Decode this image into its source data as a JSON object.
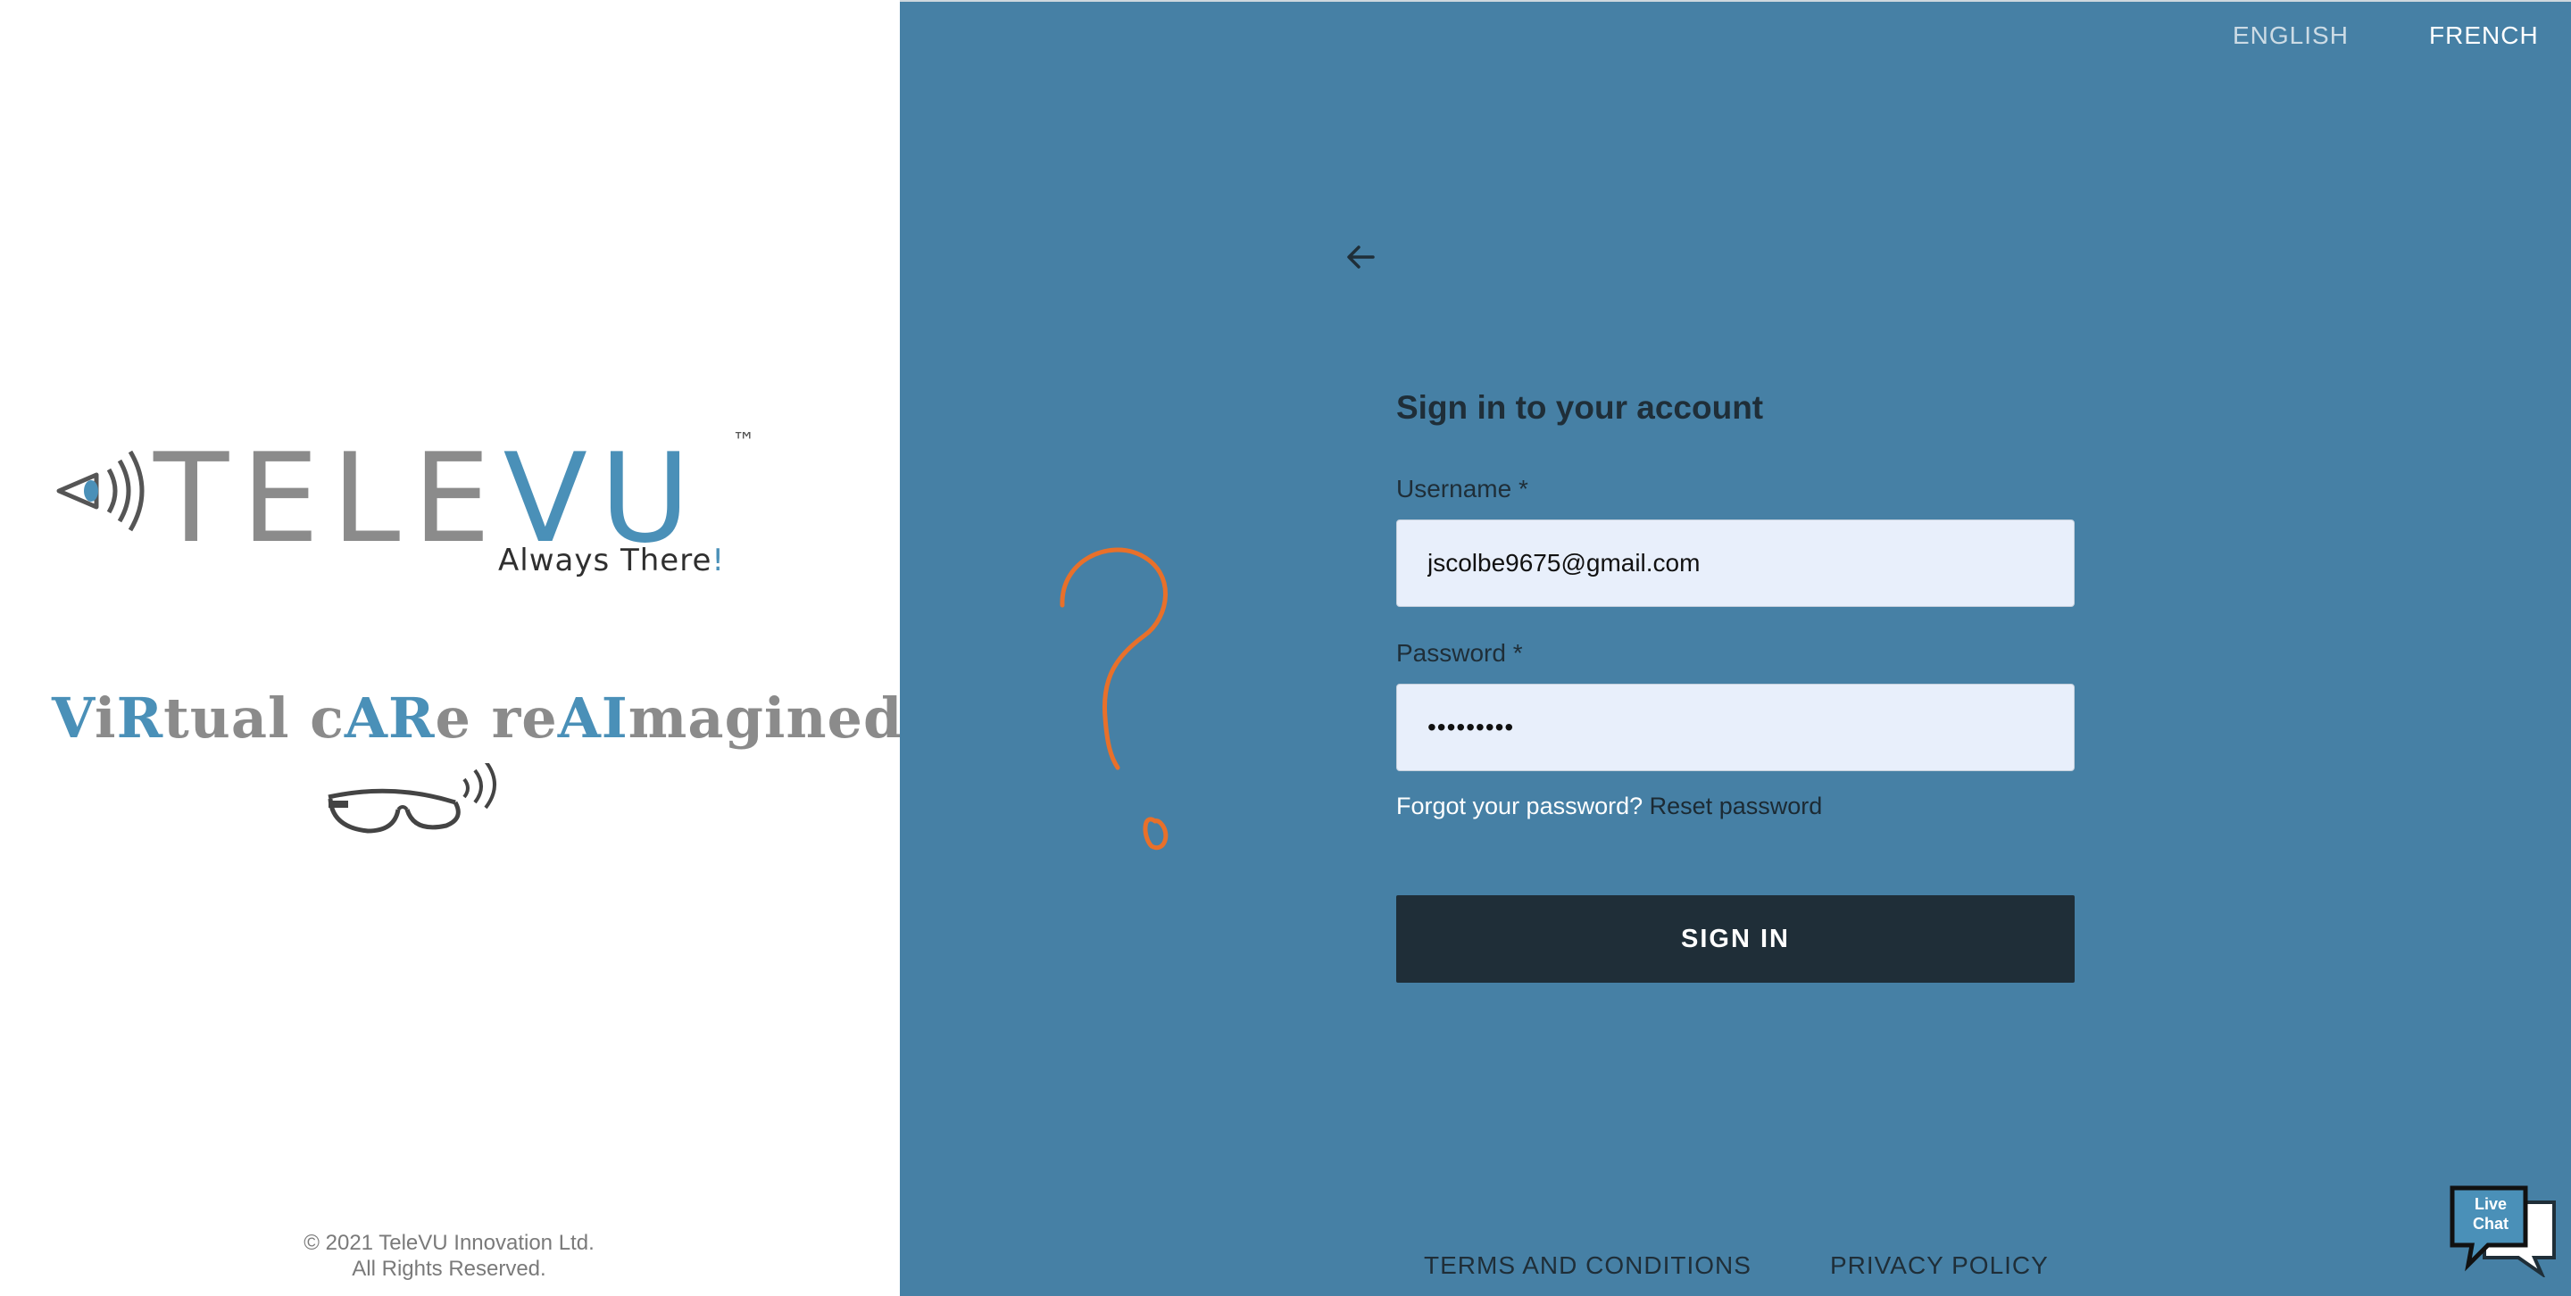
{
  "brand": {
    "logo_word_part1": "TELE",
    "logo_word_part2": "VU",
    "logo_tm": "™",
    "tagline_main": "Always There",
    "tagline_bang": "!",
    "slogan": [
      {
        "t": "V",
        "hi": true
      },
      {
        "t": "i",
        "hi": false
      },
      {
        "t": "R",
        "hi": true
      },
      {
        "t": "tual c",
        "hi": false
      },
      {
        "t": "AR",
        "hi": true
      },
      {
        "t": "e re",
        "hi": false
      },
      {
        "t": "AI",
        "hi": true
      },
      {
        "t": "magined",
        "hi": false
      }
    ],
    "copyright_line1": "© 2021 TeleVU Innovation Ltd.",
    "copyright_line2": "All Rights Reserved."
  },
  "language": {
    "english": "ENGLISH",
    "french": "FRENCH"
  },
  "form": {
    "title": "Sign in to your account",
    "username_label": "Username *",
    "username_value": "jscolbe9675@gmail.com",
    "password_label": "Password *",
    "password_value": "•••••••••",
    "forgot_text": "Forgot your password?",
    "reset_link": "Reset password",
    "signin_button": "SIGN IN"
  },
  "footer": {
    "terms": "TERMS AND CONDITIONS",
    "privacy": "PRIVACY POLICY"
  },
  "live_chat": {
    "line1": "Live",
    "line2": "Chat"
  },
  "colors": {
    "panel_blue": "#4680a5",
    "brand_blue": "#4a90b8",
    "brand_grey": "#8b8b8b",
    "dark_navy": "#1f2e38",
    "annotation_orange": "#e8702a"
  },
  "icons": {
    "back": "arrow-left-icon",
    "logo": "eye-waves-icon",
    "glasses": "smart-glasses-icon",
    "chat": "live-chat-icon"
  }
}
